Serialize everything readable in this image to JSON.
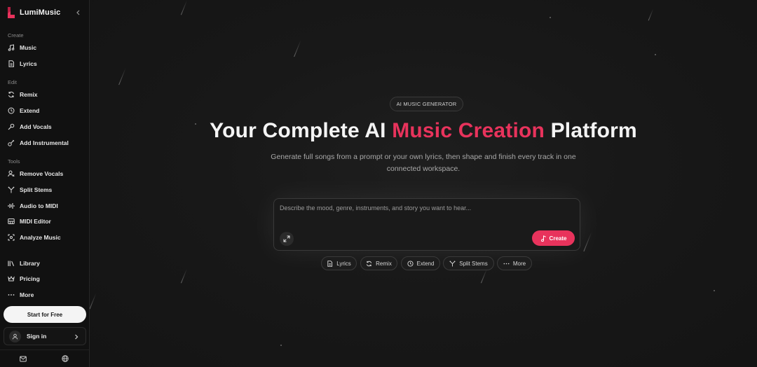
{
  "brand": {
    "name": "LumiMusic",
    "accent": "#e8335c"
  },
  "sidebar": {
    "sections": [
      {
        "label": "Create",
        "items": [
          {
            "label": "Music",
            "icon": "music-note-icon"
          },
          {
            "label": "Lyrics",
            "icon": "document-icon"
          }
        ]
      },
      {
        "label": "Edit",
        "items": [
          {
            "label": "Remix",
            "icon": "refresh-icon"
          },
          {
            "label": "Extend",
            "icon": "clock-icon"
          },
          {
            "label": "Add Vocals",
            "icon": "microphone-icon"
          },
          {
            "label": "Add Instrumental",
            "icon": "guitar-icon"
          }
        ]
      },
      {
        "label": "Tools",
        "items": [
          {
            "label": "Remove Vocals",
            "icon": "user-remove-icon"
          },
          {
            "label": "Split Stems",
            "icon": "split-icon"
          },
          {
            "label": "Audio to MIDI",
            "icon": "waveform-icon"
          },
          {
            "label": "MIDI Editor",
            "icon": "piano-icon"
          },
          {
            "label": "Analyze Music",
            "icon": "scan-icon"
          }
        ]
      }
    ],
    "bottom_items": [
      {
        "label": "Library",
        "icon": "library-icon"
      },
      {
        "label": "Pricing",
        "icon": "crown-icon"
      },
      {
        "label": "More",
        "icon": "more-icon"
      }
    ],
    "start_label": "Start for Free",
    "signin_label": "Sign in"
  },
  "hero": {
    "badge": "AI MUSIC GENERATOR",
    "headline_pre": "Your Complete AI ",
    "headline_accent": "Music Creation",
    "headline_post": " Platform",
    "subtitle": "Generate full songs from a prompt or your own lyrics, then shape and finish every track in one connected workspace."
  },
  "prompt": {
    "placeholder": "Describe the mood, genre, instruments, and story you want to hear...",
    "create_label": "Create"
  },
  "chips": [
    {
      "label": "Lyrics",
      "icon": "document-icon"
    },
    {
      "label": "Remix",
      "icon": "refresh-icon"
    },
    {
      "label": "Extend",
      "icon": "clock-icon"
    },
    {
      "label": "Split Stems",
      "icon": "split-icon"
    },
    {
      "label": "More",
      "icon": "more-icon"
    }
  ]
}
